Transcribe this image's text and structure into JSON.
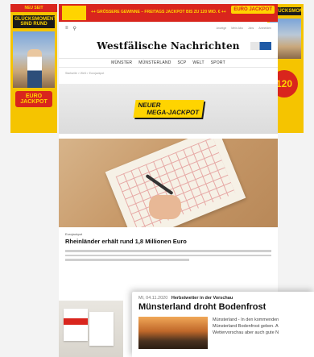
{
  "ads": {
    "top_banner_text": "++ GRÖSSERE GEWINNE – FREITAGS JACKPOT BIS ZU 120 MIO. € ++",
    "top_banner_logo": "EURO JACKPOT",
    "left_badge": "NEU SEIT",
    "left_headline": "GLÜCKSMOMENTE SIND RUND",
    "left_logo": "EURO JACKPOT",
    "right_headline": "GLÜCKSMOMENTE",
    "right_number": "120",
    "hero_line1": "NEUER",
    "hero_line2": "MEGA-JACKPOT"
  },
  "header": {
    "logo": "Westfälische Nachrichten",
    "utility_links": [
      "Anzeige",
      "Mein Abo",
      "Jobs",
      "Anmelden"
    ],
    "nav": [
      "Münster",
      "Münsterland",
      "SCP",
      "Welt",
      "Sport"
    ],
    "breadcrumb": "Startseite > Welt > Eurojackpot"
  },
  "article": {
    "kicker": "Eurojackpot",
    "headline": "Rheinländer erhält rund 1,8 Millionen Euro"
  },
  "overlay": {
    "date": "MI, 04.11.2020",
    "tag": "Herbstwetter in der Vorschau",
    "title": "Münsterland droht Bodenfrost",
    "snippet_1": "Münsterland - In den kommenden",
    "snippet_2": "Münsterland Bodenfrost geben. A",
    "snippet_3": "Wettervorschau aber auch gute N"
  }
}
